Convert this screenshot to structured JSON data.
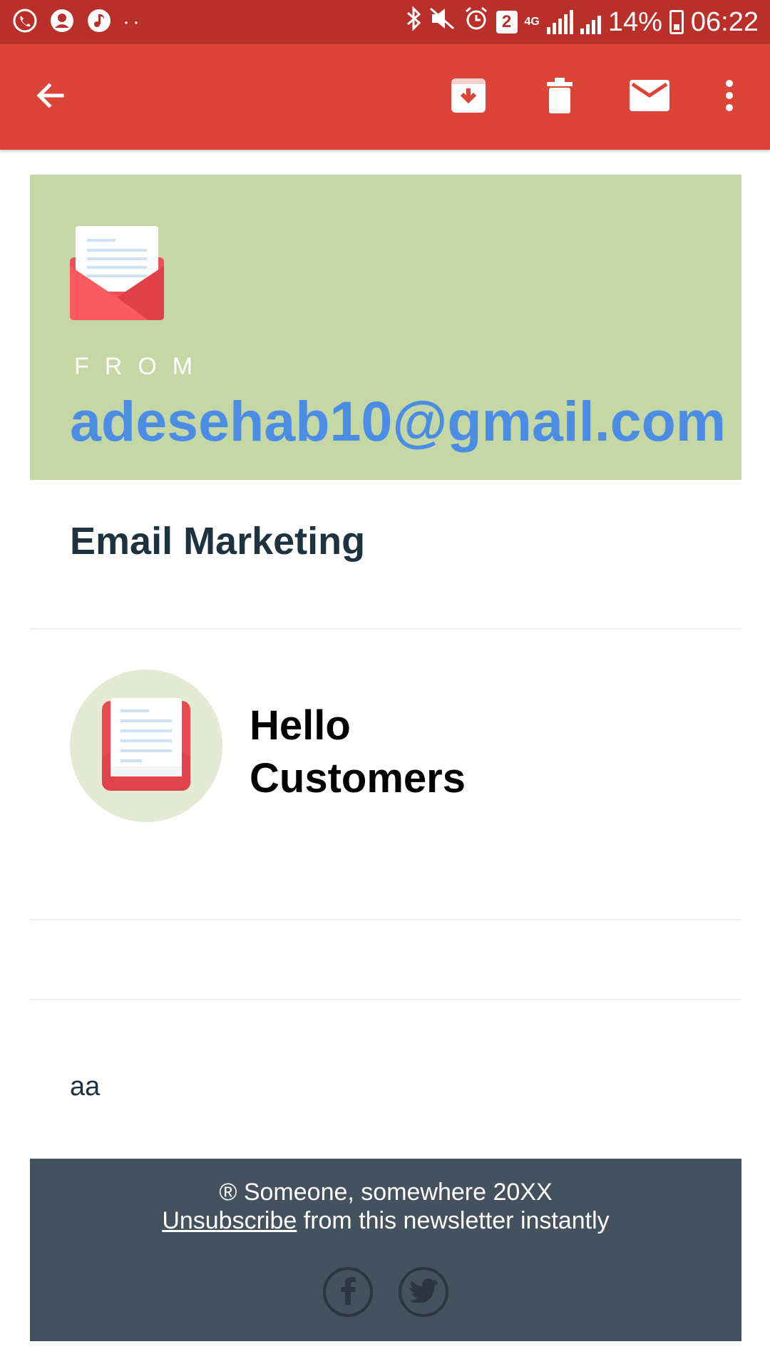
{
  "status_bar": {
    "battery_percent": "14%",
    "time": "06:22",
    "sim_badge": "2",
    "network_type": "4G",
    "left_icons": [
      "whatsapp-icon",
      "account-icon",
      "music-icon"
    ],
    "right_icons": [
      "bluetooth-icon",
      "mute-icon",
      "alarm-icon",
      "sim-icon",
      "signal-icon",
      "battery-icon"
    ]
  },
  "toolbar": {
    "icons": [
      "back-arrow-icon",
      "archive-icon",
      "delete-icon",
      "mail-icon",
      "more-vert-icon"
    ],
    "color": "#db4437"
  },
  "email": {
    "from_label": "FROM",
    "from_address": "adesehab10@gmail.com",
    "subject": "Email Marketing",
    "greeting": "Hello Customers",
    "body": "aa",
    "colors": {
      "from_panel": "#c6d7a6",
      "email_link": "#4b8de5",
      "footer": "#44525f"
    }
  },
  "footer": {
    "copyright": "® Someone, somewhere 20XX",
    "unsubscribe_link": "Unsubscribe",
    "unsubscribe_rest": " from this newsletter instantly",
    "social": [
      "facebook-icon",
      "twitter-icon"
    ]
  }
}
